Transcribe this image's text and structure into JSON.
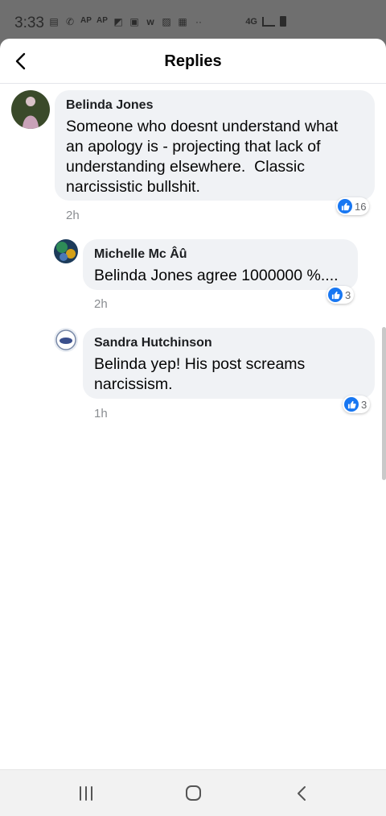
{
  "status_bar": {
    "time": "3:33",
    "notification_icons": [
      "messages-icon",
      "wifi-call-icon",
      "ap-icon",
      "ap-icon",
      "photo-icon",
      "news-icon",
      "w-icon",
      "gallery-icon",
      "calendar-icon",
      "more-dots-icon"
    ],
    "network": "4G"
  },
  "header": {
    "title": "Replies",
    "back_icon": "chevron-left-icon"
  },
  "comments": [
    {
      "author": "Belinda Jones",
      "text_lines": [
        "Someone who doesnt understand what",
        "an apology is - projecting that lack of",
        "understanding elsewhere.  Classic",
        "narcissistic bullshit."
      ],
      "time": "2h",
      "likes": "16"
    },
    {
      "author": "Michelle Mc Âû",
      "text_lines": [
        "Belinda Jones agree 1000000 %...."
      ],
      "time": "2h",
      "likes": "3"
    },
    {
      "author": "Sandra Hutchinson",
      "text_lines": [
        "Belinda yep! His post screams",
        "narcissism."
      ],
      "time": "1h",
      "likes": "3"
    }
  ],
  "colors": {
    "like_blue": "#1877f2",
    "bubble_bg": "#f0f2f5",
    "meta_gray": "#8a8d91"
  },
  "nav_bar": {
    "buttons": [
      "recent-apps-icon",
      "home-icon",
      "back-icon"
    ]
  }
}
